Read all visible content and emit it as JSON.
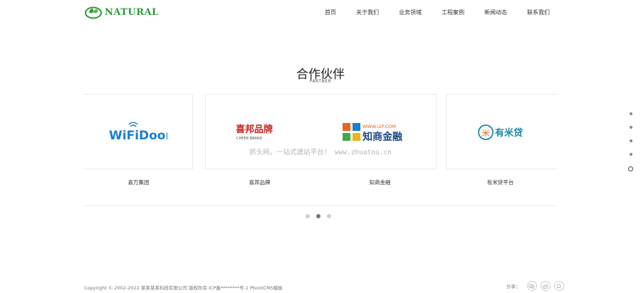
{
  "header": {
    "logo_text": "NATURAL",
    "nav": [
      "首页",
      "关于我们",
      "业务领域",
      "工程案例",
      "新闻动态",
      "联系我们"
    ]
  },
  "partners_section": {
    "title": "合作伙伴",
    "subtitle": "PARTNER",
    "logos": [
      {
        "name": "WiFiDoor"
      },
      {
        "name": "喜邦品牌",
        "sub": "CHEER BRAND"
      },
      {
        "name": "知商金融",
        "sub": "WWW.I2P.COM"
      },
      {
        "name": "有米贷"
      }
    ],
    "labels": [
      "喜万集团",
      "喜邦品牌",
      "知商金融",
      "有米贷平台"
    ]
  },
  "watermark": "抓头网，一站式建站平台！ www.zhuatou.cn",
  "carousel": {
    "pages": 3,
    "active": 2
  },
  "side_nav": {
    "count": 5,
    "active": 5
  },
  "footer": {
    "copyright": "Copyright © 2002-2022 某某某某科技有限公司 版权所有",
    "icp": "ICP备********号-1",
    "powered": "PbootCMS模板",
    "share_label": "分享："
  },
  "colors": {
    "brand": "#2e9b3a",
    "wifi_blue": "#1a7ecf",
    "cheer_red": "#c9241f",
    "i2p_orange": "#e8631b",
    "youmi_teal": "#1b8aa8"
  }
}
